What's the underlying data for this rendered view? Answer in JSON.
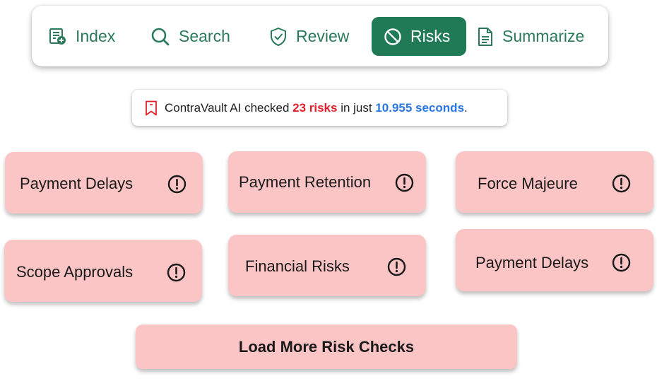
{
  "nav": {
    "index": {
      "label": "Index",
      "icon": "index-add-icon"
    },
    "search": {
      "label": "Search",
      "icon": "search-icon"
    },
    "review": {
      "label": "Review",
      "icon": "shield-check-icon"
    },
    "risks": {
      "label": "Risks",
      "icon": "ban-icon",
      "active": true
    },
    "summarize": {
      "label": "Summarize",
      "icon": "document-icon"
    }
  },
  "status": {
    "icon": "bookmark-icon",
    "prefix": "ContraVault AI checked ",
    "risk_count": "23 risks",
    "middle": " in just ",
    "duration": "10.955 seconds",
    "suffix": "."
  },
  "cards": [
    {
      "label": "Payment Delays",
      "icon": "alert-circle-icon"
    },
    {
      "label": "Payment Retention",
      "icon": "alert-circle-icon"
    },
    {
      "label": "Force Majeure",
      "icon": "alert-circle-icon"
    },
    {
      "label": "Scope Approvals",
      "icon": "alert-circle-icon"
    },
    {
      "label": "Financial Risks",
      "icon": "alert-circle-icon"
    },
    {
      "label": "Payment Delays",
      "icon": "alert-circle-icon"
    }
  ],
  "load_more_label": "Load More Risk Checks",
  "colors": {
    "brand_green": "#1f7a55",
    "card_pink": "#fcc5c5",
    "risk_red": "#e0202a",
    "time_blue": "#2a76e0"
  }
}
